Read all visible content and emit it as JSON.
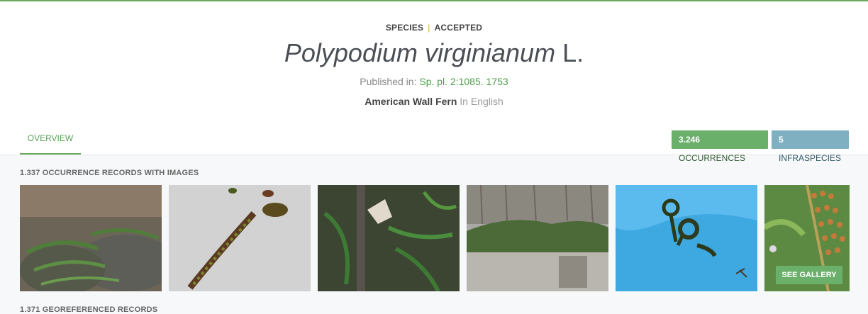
{
  "header": {
    "rank": "SPECIES",
    "status": "ACCEPTED",
    "scientific_name": "Polypodium virginianum",
    "authorship": "L.",
    "published_prefix": "Published in:",
    "published_ref": "Sp. pl. 2:1085. 1753",
    "vernacular_name": "American Wall Fern",
    "vernacular_lang": "In English"
  },
  "tabs": [
    {
      "label": "OVERVIEW",
      "active": true
    }
  ],
  "badges": {
    "occurrences_count": "3.246",
    "occurrences_label": "OCCURRENCES",
    "infraspecies_count": "5",
    "infraspecies_label": "INFRASPECIES"
  },
  "images_section": {
    "label": "1.337 OCCURRENCE RECORDS WITH IMAGES",
    "see_gallery": "SEE GALLERY",
    "images": [
      {
        "icon": "fern-on-rock-photo"
      },
      {
        "icon": "fern-in-snow-photo"
      },
      {
        "icon": "fern-with-leaves-photo"
      },
      {
        "icon": "fern-on-cliff-photo"
      },
      {
        "icon": "fern-fiddleheads-photo"
      },
      {
        "icon": "fern-sori-closeup-photo"
      }
    ]
  },
  "georef_section": {
    "label": "1.371 GEOREFERENCED RECORDS"
  },
  "colors": {
    "accent_green": "#6aa85f",
    "badge_green": "#6aaf6a",
    "badge_blue": "#7fb0c2",
    "separator_gold": "#d4a62a"
  }
}
